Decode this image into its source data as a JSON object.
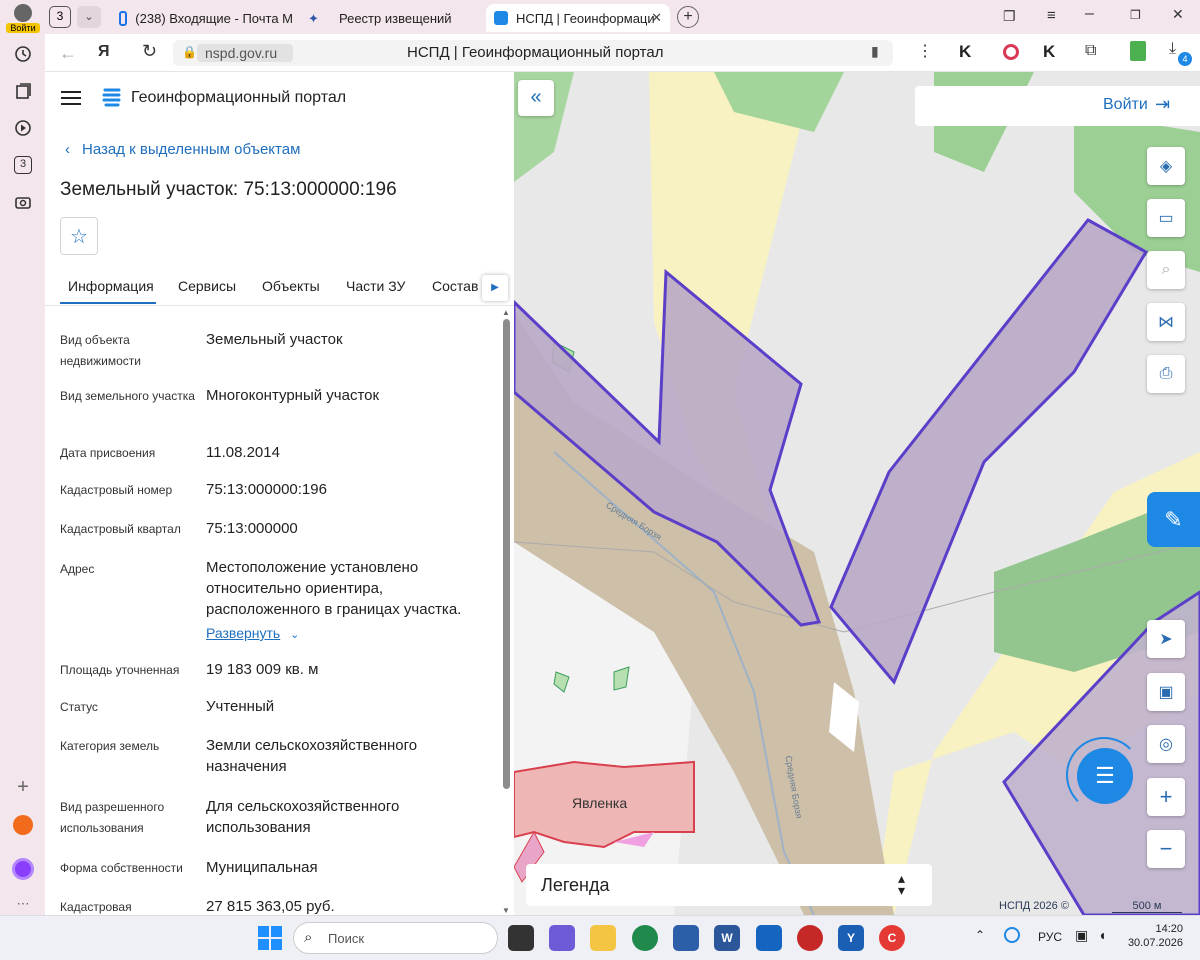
{
  "sidebar": {
    "login_label": "Войти",
    "tab_count": "3"
  },
  "tabs": {
    "count_badge": "3",
    "items": [
      {
        "label": "(238) Входящие - Почта М"
      },
      {
        "label": "Реестр извещений"
      },
      {
        "label": "НСПД | Геоинформационный портал"
      }
    ]
  },
  "address": {
    "url": "nspd.gov.ru",
    "page_title": "НСПД | Геоинформационный портал",
    "ext_badge": "4"
  },
  "portal": {
    "title": "Геоинформационный портал"
  },
  "panel": {
    "back_label": "Назад к выделенным объектам",
    "heading": "Земельный участок: 75:13:000000:196",
    "tabs": [
      "Информация",
      "Сервисы",
      "Объекты",
      "Части ЗУ",
      "Состав"
    ],
    "expand_label": "Развернуть",
    "props": [
      {
        "label": "Вид объекта недвижимости",
        "value": "Земельный участок"
      },
      {
        "label": "Вид земельного участка",
        "value": "Многоконтурный участок"
      },
      {
        "label": "Дата присвоения",
        "value": "11.08.2014"
      },
      {
        "label": "Кадастровый номер",
        "value": "75:13:000000:196"
      },
      {
        "label": "Кадастровый квартал",
        "value": "75:13:000000"
      },
      {
        "label": "Адрес",
        "value": "Местоположение установлено относительно ориентира, расположенного в границах участка."
      },
      {
        "label": "Площадь уточненная",
        "value": "19 183 009 кв. м"
      },
      {
        "label": "Статус",
        "value": "Учтенный"
      },
      {
        "label": "Категория земель",
        "value": "Земли сельскохозяйственного назначения"
      },
      {
        "label": "Вид разрешенного использования",
        "value": "Для сельскохозяйственного использования"
      },
      {
        "label": "Форма собственности",
        "value": "Муниципальная"
      },
      {
        "label": "Кадастровая",
        "value": "27 815 363,05 руб."
      }
    ]
  },
  "map": {
    "login_label": "Войти",
    "legend_label": "Легенда",
    "copyright": "НСПД 2026 ©",
    "scale_label": "500 м",
    "river_label": "Средняя Борзя",
    "river_label_2": "Средняя Борзя",
    "village_label": "Явленка"
  },
  "taskbar": {
    "search_placeholder": "Поиск",
    "lang": "РУС",
    "time": "14:20",
    "date": "30.07.2026"
  }
}
